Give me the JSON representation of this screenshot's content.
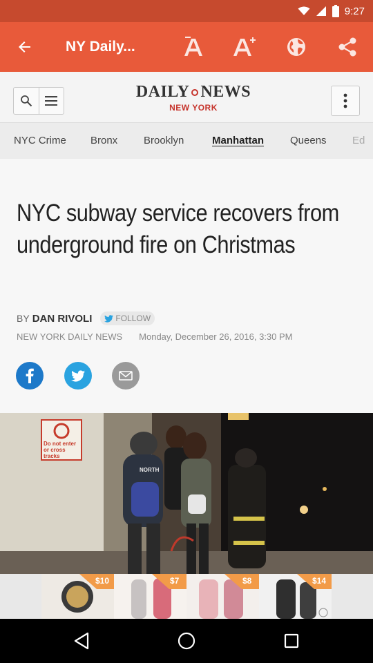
{
  "status_bar": {
    "time": "9:27"
  },
  "toolbar": {
    "title": "NY Daily...",
    "icons": [
      "back-arrow-icon",
      "font-decrease-icon",
      "font-increase-icon",
      "globe-icon",
      "share-icon"
    ],
    "color": "#e85a3a"
  },
  "header": {
    "logo_name_left": "DAILY",
    "logo_name_right": "NEWS",
    "logo_city": "NEW YORK"
  },
  "sections": [
    {
      "label": "NYC Crime"
    },
    {
      "label": "Bronx"
    },
    {
      "label": "Brooklyn"
    },
    {
      "label": "Manhattan",
      "active": true
    },
    {
      "label": "Queens"
    },
    {
      "label": "Ed"
    }
  ],
  "article": {
    "headline": "NYC subway service recovers from underground fire on Christmas",
    "by_prefix": "BY",
    "author": "DAN RIVOLI",
    "follow_label": "FOLLOW",
    "source": "NEW YORK DAILY NEWS",
    "date": "Monday, December 26, 2016, 3:30 PM"
  },
  "photo": {
    "sign_text": "Do not enter or cross tracks",
    "jacket_text": "NORTH"
  },
  "ad": {
    "prices": [
      "$10",
      "$7",
      "$8",
      "$14"
    ]
  },
  "colors": {
    "accent": "#e85a3a",
    "status_bar": "#c64a2e",
    "facebook": "#1d79c9",
    "twitter": "#2aa3e0",
    "email": "#9a9a9a",
    "logo_red": "#c6332b"
  }
}
